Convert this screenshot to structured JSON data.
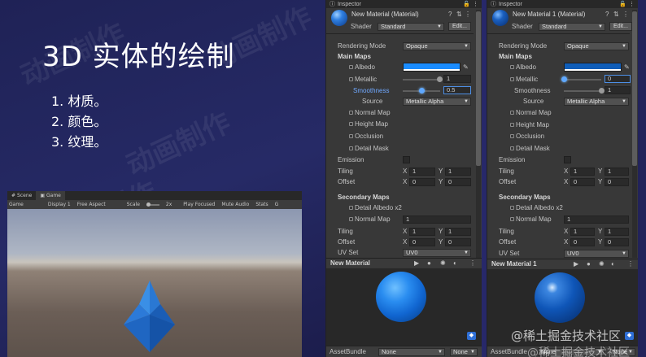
{
  "slide": {
    "title": "3D 实体的绘制",
    "list": [
      "1. 材质。",
      "2. 颜色。",
      "3. 纹理。"
    ],
    "watermark": "动画制作"
  },
  "unity_window": {
    "tabs": [
      "Scene",
      "Game"
    ],
    "toolbar": [
      "Game",
      "Display 1",
      "Free Aspect",
      "Scale",
      "2x",
      "Play Focused",
      "Mute Audio",
      "Stats",
      "G"
    ]
  },
  "inspectors": [
    {
      "tab_label": "Inspector",
      "material_name": "New Material (Material)",
      "shader_label": "Shader",
      "shader_value": "Standard",
      "edit_button": "Edit...",
      "rendering_mode_label": "Rendering Mode",
      "rendering_mode_value": "Opaque",
      "main_maps_label": "Main Maps",
      "albedo_label": "Albedo",
      "albedo_color": "#1a8cff",
      "metallic_label": "Metallic",
      "metallic_value": "1",
      "metallic_level": 0.98,
      "smoothness_label": "Smoothness",
      "smoothness_value": "0.5",
      "smoothness_level": 0.5,
      "source_label": "Source",
      "source_value": "Metallic Alpha",
      "map_items": [
        "Normal Map",
        "Height Map",
        "Occlusion",
        "Detail Mask"
      ],
      "emission_label": "Emission",
      "tiling_label": "Tiling",
      "offset_label": "Offset",
      "x_label": "X",
      "y_label": "Y",
      "tiling_x": "1",
      "tiling_y": "1",
      "offset_x": "0",
      "offset_y": "0",
      "secondary_maps_label": "Secondary Maps",
      "detail_albedo_label": "Detail Albedo x2",
      "secondary_normal_label": "Normal Map",
      "secondary_normal_value": "1",
      "sec_tiling_x": "1",
      "sec_tiling_y": "1",
      "sec_offset_x": "0",
      "sec_offset_y": "0",
      "uv_set_label": "UV Set",
      "uv_set_value": "UV0",
      "preview_label": "New Material",
      "asset_bundle_label": "AssetBundle",
      "asset_bundle_value": "None",
      "asset_bundle_variant": "None"
    },
    {
      "tab_label": "Inspector",
      "material_name": "New Material 1 (Material)",
      "shader_label": "Shader",
      "shader_value": "Standard",
      "edit_button": "Edit...",
      "rendering_mode_label": "Rendering Mode",
      "rendering_mode_value": "Opaque",
      "main_maps_label": "Main Maps",
      "albedo_label": "Albedo",
      "albedo_color": "#0f5db8",
      "metallic_label": "Metallic",
      "metallic_value": "0",
      "metallic_level": 0.0,
      "smoothness_label": "Smoothness",
      "smoothness_value": "1",
      "smoothness_level": 1.0,
      "source_label": "Source",
      "source_value": "Metallic Alpha",
      "map_items": [
        "Normal Map",
        "Height Map",
        "Occlusion",
        "Detail Mask"
      ],
      "emission_label": "Emission",
      "tiling_label": "Tiling",
      "offset_label": "Offset",
      "x_label": "X",
      "y_label": "Y",
      "tiling_x": "1",
      "tiling_y": "1",
      "offset_x": "0",
      "offset_y": "0",
      "secondary_maps_label": "Secondary Maps",
      "detail_albedo_label": "Detail Albedo x2",
      "secondary_normal_label": "Normal Map",
      "secondary_normal_value": "1",
      "sec_tiling_x": "1",
      "sec_tiling_y": "1",
      "sec_offset_x": "0",
      "sec_offset_y": "0",
      "uv_set_label": "UV Set",
      "uv_set_value": "UV0",
      "preview_label": "New Material 1",
      "asset_bundle_label": "AssetBundle",
      "asset_bundle_value": "None",
      "asset_bundle_variant": "None"
    }
  ],
  "footer_watermark": "@稀土掘金技术社区",
  "footer_watermark_2": "@稀土掘金技术社区"
}
